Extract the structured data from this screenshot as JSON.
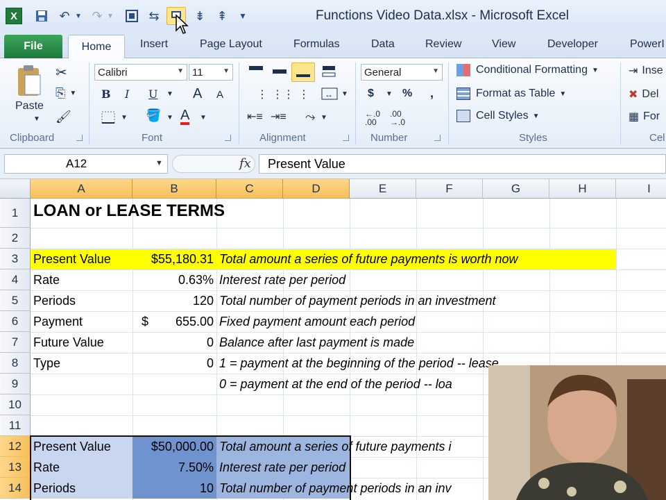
{
  "window": {
    "title": "Functions Video Data.xlsx  -  Microsoft Excel",
    "app_icon_letter": "X"
  },
  "tabs": [
    "File",
    "Home",
    "Insert",
    "Page Layout",
    "Formulas",
    "Data",
    "Review",
    "View",
    "Developer",
    "PowerI"
  ],
  "ribbon": {
    "clipboard": {
      "paste": "Paste",
      "label": "Clipboard"
    },
    "font": {
      "name": "Calibri",
      "size": "11",
      "label": "Font",
      "bold": "B",
      "italic": "I",
      "underline": "U",
      "grow": "A",
      "shrink": "A",
      "color_letter": "A"
    },
    "alignment": {
      "label": "Alignment"
    },
    "number": {
      "format": "General",
      "currency": "$",
      "percent": "%",
      "comma": ",",
      "label": "Number"
    },
    "styles": {
      "conditional": "Conditional Formatting",
      "table": "Format as Table",
      "cell": "Cell Styles",
      "label": "Styles"
    },
    "cells": {
      "insert": "Inse",
      "delete": "Del",
      "format": "For",
      "label": "Cel"
    }
  },
  "formula_bar": {
    "name_box": "A12",
    "fx": "fx",
    "content": "Present Value"
  },
  "columns": [
    "A",
    "B",
    "C",
    "D",
    "E",
    "F",
    "G",
    "H",
    "I"
  ],
  "rows": [
    "1",
    "2",
    "3",
    "4",
    "5",
    "6",
    "7",
    "8",
    "9",
    "10",
    "11",
    "12",
    "13",
    "14"
  ],
  "sheet": {
    "title": "LOAN or LEASE TERMS",
    "rows": [
      {
        "label": "Present Value",
        "value": "$55,180.31",
        "note": "Total amount a series of future payments is worth now"
      },
      {
        "label": "Rate",
        "value": "0.63%",
        "note": "Interest rate per period"
      },
      {
        "label": "Periods",
        "value": "120",
        "note": "Total number of payment periods in an investment"
      },
      {
        "label": "Payment",
        "value_prefix": "$",
        "value": "655.00",
        "note": "Fixed payment amount each period"
      },
      {
        "label": "Future Value",
        "value": "0",
        "note": "Balance after last payment is made"
      },
      {
        "label": "Type",
        "value": "0",
        "note": "1 = payment at the beginning of the period -- lease"
      },
      {
        "label": "",
        "value": "",
        "note": "0 = payment at the end of the period -- loa"
      }
    ],
    "lower_rows": [
      {
        "label": "Present Value",
        "value": "$50,000.00",
        "note": "Total amount a series of future payments i"
      },
      {
        "label": "Rate",
        "value": "7.50%",
        "note": "Interest rate per period"
      },
      {
        "label": "Periods",
        "value": "10",
        "note": "Total number of payment periods in an inv"
      }
    ]
  },
  "colors": {
    "highlight": "#ffff00",
    "selection": "#9cb6e0",
    "header_selected": "#f6c05a",
    "file_tab": "#1d7b3c"
  }
}
